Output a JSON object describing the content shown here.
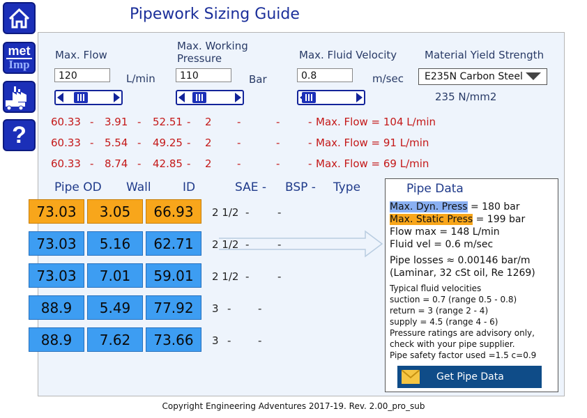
{
  "app": {
    "title": "Pipework Sizing Guide"
  },
  "nav": {
    "home": "home-icon",
    "units_top": "met",
    "units_bottom": "Imp",
    "factory": "factory-icon",
    "help": "?"
  },
  "inputs": {
    "flow": {
      "label": "Max. Flow",
      "value": "120",
      "unit": "L/min",
      "slider_level": 0.4
    },
    "pressure": {
      "label1": "Max. Working",
      "label2": "Pressure",
      "value": "110",
      "unit": "Bar",
      "slider_level": 0.35
    },
    "velocity": {
      "label": "Max. Fluid Velocity",
      "value": "0.8",
      "unit": "m/sec",
      "slider_level": 0.1
    },
    "material": {
      "label": "Material Yield Strength",
      "selected": "E235N Carbon Steel",
      "strength": "235  N/mm2"
    }
  },
  "results": [
    {
      "od": "60.33",
      "sep1": "-",
      "wall": "3.91",
      "sep2": "-",
      "id": "52.51",
      "sep3": "-",
      "sae": "2",
      "sep4": "-",
      "sep5": "-",
      "sep6": "-",
      "flow": "Max. Flow = 104 L/min"
    },
    {
      "od": "60.33",
      "sep1": "-",
      "wall": "5.54",
      "sep2": "-",
      "id": "49.25",
      "sep3": "-",
      "sae": "2",
      "sep4": "-",
      "sep5": "-",
      "sep6": "-",
      "flow": "Max. Flow = 91 L/min"
    },
    {
      "od": "60.33",
      "sep1": "-",
      "wall": "8.74",
      "sep2": "-",
      "id": "42.85",
      "sep3": "-",
      "sae": "2",
      "sep4": "-",
      "sep5": "-",
      "sep6": "-",
      "flow": "Max. Flow = 69 L/min"
    }
  ],
  "table": {
    "headers": {
      "od": "Pipe OD",
      "wall": "Wall",
      "id": "ID",
      "sae": "SAE -",
      "bsp": "BSP -",
      "type": "Type"
    },
    "rows": [
      {
        "od": "73.03",
        "wall": "3.05",
        "id": "66.93",
        "sae": "2 1/2",
        "d1": "-",
        "d2": "-",
        "selected": true
      },
      {
        "od": "73.03",
        "wall": "5.16",
        "id": "62.71",
        "sae": "2 1/2",
        "d1": "-",
        "d2": "-",
        "selected": false
      },
      {
        "od": "73.03",
        "wall": "7.01",
        "id": "59.01",
        "sae": "2 1/2",
        "d1": "-",
        "d2": "-",
        "selected": false
      },
      {
        "od": "88.9",
        "wall": "5.49",
        "id": "77.92",
        "sae": "3",
        "d1": "-",
        "d2": "-",
        "selected": false
      },
      {
        "od": "88.9",
        "wall": "7.62",
        "id": "73.66",
        "sae": "3",
        "d1": "-",
        "d2": "-",
        "selected": false
      }
    ]
  },
  "pipe_data": {
    "title": "Pipe Data",
    "dyn_label": "Max. Dyn. Press",
    "dyn_value": " = 180 bar",
    "static_label": "Max. Static Press",
    "static_value": " = 199 bar",
    "flow_max": "Flow max = 148 L/min",
    "fluid_vel": "Fluid vel = 0.6 m/sec",
    "losses": "Pipe losses ≈ 0.00146 bar/m",
    "laminar": "(Laminar, 32 cSt oil, Re 1269)",
    "notes": [
      "Typical fluid velocities",
      "suction = 0.7  (range 0.5 - 0.8)",
      "return = 3 (range 2 - 4)",
      "supply = 4.5 (range 4 - 6)",
      "Pressure ratings are advisory only,",
      "check with your pipe supplier.",
      "Pipe safety factor used =1.5 c=0.9"
    ],
    "button": "Get Pipe Data",
    "button_icon": "envelope-icon"
  },
  "colors": {
    "accent_blue": "#3d9df2",
    "selected_orange": "#f8a61b",
    "nav_blue": "#1b2fb8",
    "warning_red": "#c41818"
  },
  "footer": "Copyright Engineering Adventures 2017-19.   Rev. 2.00_pro_sub"
}
